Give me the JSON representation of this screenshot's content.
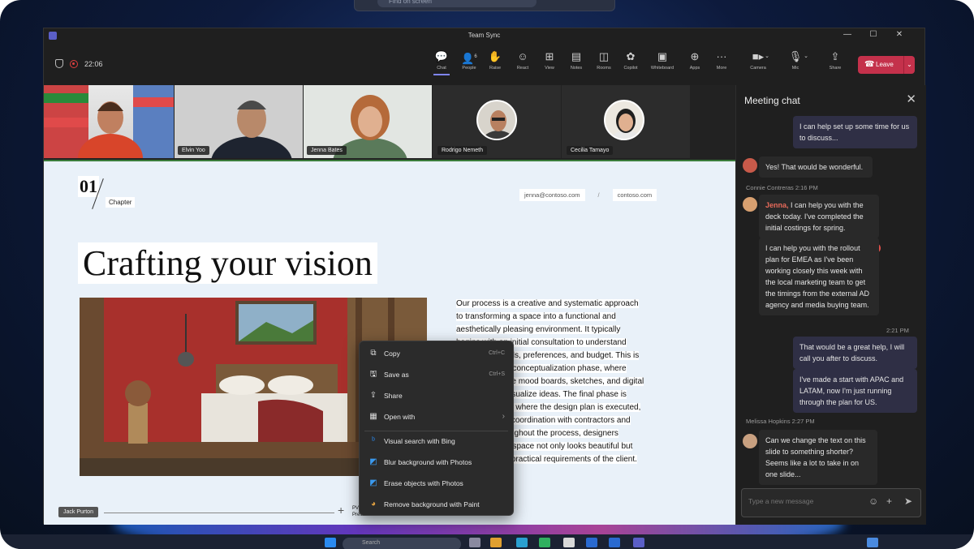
{
  "desktop": {
    "search_placeholder": "Find on screen"
  },
  "window": {
    "title": "Team Sync"
  },
  "toolbar": {
    "timer": "22:06",
    "buttons": [
      {
        "label": "Chat",
        "icon": "chat-icon"
      },
      {
        "label": "People",
        "icon": "people-icon",
        "count": "6"
      },
      {
        "label": "Raise",
        "icon": "raise-hand-icon"
      },
      {
        "label": "React",
        "icon": "react-icon"
      },
      {
        "label": "View",
        "icon": "view-icon"
      },
      {
        "label": "Notes",
        "icon": "notes-icon"
      },
      {
        "label": "Rooms",
        "icon": "rooms-icon"
      },
      {
        "label": "Copilot",
        "icon": "copilot-icon"
      },
      {
        "label": "Whiteboard",
        "icon": "whiteboard-icon"
      },
      {
        "label": "Apps",
        "icon": "apps-icon"
      },
      {
        "label": "More",
        "icon": "more-icon"
      },
      {
        "label": "Camera",
        "icon": "camera-icon"
      },
      {
        "label": "Mic",
        "icon": "mic-icon"
      },
      {
        "label": "Share",
        "icon": "share-icon"
      }
    ],
    "leave_label": "Leave"
  },
  "participants": [
    {
      "name": ""
    },
    {
      "name": "Elvin Yoo"
    },
    {
      "name": "Jenna Bates"
    },
    {
      "name": "Rodrigo Nemeth"
    },
    {
      "name": "Cecilia Tamayo"
    }
  ],
  "slide": {
    "chapter_number": "01",
    "chapter_label": "Chapter",
    "email": "jenna@contoso.com",
    "website": "contoso.com",
    "title": "Crafting your vision",
    "body_lines": [
      "Our process is a creative and systematic approach",
      "to transforming a space into a functional and",
      "aesthetically pleasing environment. It typically",
      "begins with an initial consultation to understand",
      "the client's needs, preferences, and budget. This is",
      "followed by the conceptualization phase, where",
      "designers create mood boards, sketches, and digital",
      "renderings to visualize ideas. The final phase is",
      "implementation, where the design plan is executed,",
      "involving close coordination with contractors and",
      "suppliers. Throughout the process, designers",
      "ensure that the space not only looks beautiful but",
      "also meets the practical requirements of the client."
    ],
    "presenter": "Jack Purton",
    "pv_label_1": "PV",
    "pv_label_2": "Presentation"
  },
  "context_menu": {
    "items": [
      {
        "label": "Copy",
        "shortcut": "Ctrl+C",
        "icon": "copy-icon"
      },
      {
        "label": "Save as",
        "shortcut": "Ctrl+S",
        "icon": "save-icon"
      },
      {
        "label": "Share",
        "shortcut": "",
        "icon": "share-icon"
      },
      {
        "label": "Open with",
        "shortcut": "›",
        "icon": "open-with-icon"
      },
      {
        "label": "Visual search with Bing",
        "shortcut": "",
        "icon": "bing-icon"
      },
      {
        "label": "Blur background with Photos",
        "shortcut": "",
        "icon": "photos-icon"
      },
      {
        "label": "Erase objects with Photos",
        "shortcut": "",
        "icon": "photos-icon"
      },
      {
        "label": "Remove background with Paint",
        "shortcut": "",
        "icon": "paint-icon"
      }
    ]
  },
  "chat": {
    "title": "Meeting chat",
    "messages": [
      {
        "text": "I can help set up some time for us to discuss..."
      },
      {
        "text": "Yes! That would be wonderful."
      },
      {
        "meta": "Connie Contreras  2:16 PM"
      },
      {
        "mention": "Jenna,",
        "text": " I can help you with the deck today. I've completed the initial costings for spring."
      },
      {
        "text": "I can help you with the rollout plan for EMEA as I've been working closely this week with the local marketing team to get the timings from the external AD agency and media buying team."
      },
      {
        "meta": "2:21 PM"
      },
      {
        "text": "That would be a great help, I will call you after to discuss."
      },
      {
        "text": "I've made a start with APAC and LATAM, now I'm just running through the plan for US."
      },
      {
        "meta": "Melissa Hopkins  2:27 PM"
      },
      {
        "text": "Can we change the text on this slide to something shorter? Seems like a lot to take in on one slide..."
      }
    ],
    "input_placeholder": "Type a new message"
  },
  "taskbar": {
    "search_label": "Search"
  }
}
